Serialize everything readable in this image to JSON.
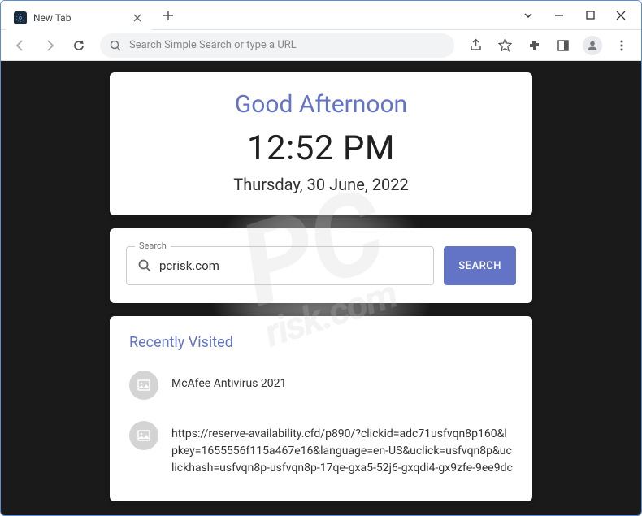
{
  "window": {
    "tab_title": "New Tab"
  },
  "toolbar": {
    "omnibox_placeholder": "Search Simple Search or type a URL"
  },
  "page": {
    "greeting": "Good Afternoon",
    "time": "12:52 PM",
    "date": "Thursday, 30 June, 2022",
    "search_label": "Search",
    "search_value": "pcrisk.com",
    "search_button": "SEARCH",
    "recent_title": "Recently Visited",
    "recent_items": [
      {
        "label": "McAfee Antivirus 2021"
      },
      {
        "label": "https://reserve-availability.cfd/p890/?clickid=adc71usfvqn8p160&lpkey=1655556f115a467e16&language=en-US&uclick=usfvqn8p&uclickhash=usfvqn8p-usfvqn8p-17qe-gxa5-52j6-gxqdi4-gx9zfe-9ee9dc"
      }
    ]
  },
  "watermark": {
    "main": "PC",
    "sub": "risk.com"
  }
}
